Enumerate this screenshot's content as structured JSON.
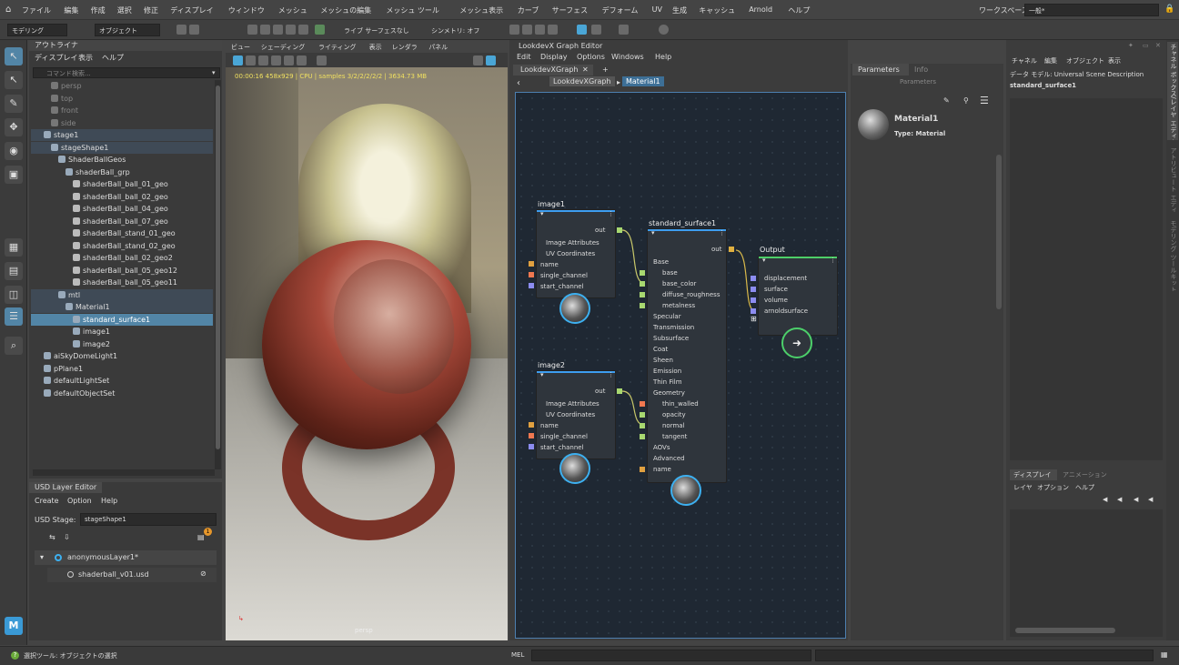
{
  "menubar": {
    "items": [
      "ファイル",
      "編集",
      "作成",
      "選択",
      "修正",
      "ディスプレイ",
      "ウィンドウ",
      "メッシュ",
      "メッシュの編集",
      "メッシュ ツール",
      "メッシュ表示",
      "カーブ",
      "サーフェス",
      "デフォーム",
      "UV",
      "生成",
      "キャッシュ",
      "Arnold",
      "ヘルプ"
    ],
    "workspace_label": "ワークスペース :",
    "workspace_value": "一般*"
  },
  "toolbar": {
    "mode": "モデリング",
    "object_label": "オブジェクト",
    "live_surface": "ライブ サーフェスなし",
    "symmetry": "シンメトリ: オフ"
  },
  "outliner": {
    "title": "アウトライナ",
    "menu": [
      "ディスプレイ",
      "表示",
      "ヘルプ"
    ],
    "search_placeholder": "コマンド検索...",
    "rows": [
      {
        "label": "persp",
        "depth": 1,
        "state": "dim"
      },
      {
        "label": "top",
        "depth": 1,
        "state": "dim"
      },
      {
        "label": "front",
        "depth": 1,
        "state": "dim"
      },
      {
        "label": "side",
        "depth": 1,
        "state": "dim"
      },
      {
        "label": "stage1",
        "depth": 0,
        "state": "hl"
      },
      {
        "label": "stageShape1",
        "depth": 1,
        "state": "hl"
      },
      {
        "label": "ShaderBallGeos",
        "depth": 2,
        "state": ""
      },
      {
        "label": "shaderBall_grp",
        "depth": 3,
        "state": ""
      },
      {
        "label": "shaderBall_ball_01_geo",
        "depth": 4,
        "state": ""
      },
      {
        "label": "shaderBall_ball_02_geo",
        "depth": 4,
        "state": ""
      },
      {
        "label": "shaderBall_ball_04_geo",
        "depth": 4,
        "state": ""
      },
      {
        "label": "shaderBall_ball_07_geo",
        "depth": 4,
        "state": ""
      },
      {
        "label": "shaderBall_stand_01_geo",
        "depth": 4,
        "state": ""
      },
      {
        "label": "shaderBall_stand_02_geo",
        "depth": 4,
        "state": ""
      },
      {
        "label": "shaderBall_ball_02_geo2",
        "depth": 4,
        "state": ""
      },
      {
        "label": "shaderBall_ball_05_geo12",
        "depth": 4,
        "state": ""
      },
      {
        "label": "shaderBall_ball_05_geo11",
        "depth": 4,
        "state": ""
      },
      {
        "label": "mtl",
        "depth": 2,
        "state": "hl"
      },
      {
        "label": "Material1",
        "depth": 3,
        "state": "hl"
      },
      {
        "label": "standard_surface1",
        "depth": 4,
        "state": "sel"
      },
      {
        "label": "image1",
        "depth": 4,
        "state": ""
      },
      {
        "label": "image2",
        "depth": 4,
        "state": ""
      },
      {
        "label": "aiSkyDomeLight1",
        "depth": 0,
        "state": ""
      },
      {
        "label": "pPlane1",
        "depth": 0,
        "state": ""
      },
      {
        "label": "defaultLightSet",
        "depth": 0,
        "state": ""
      },
      {
        "label": "defaultObjectSet",
        "depth": 0,
        "state": ""
      }
    ]
  },
  "usd": {
    "title": "USD Layer Editor",
    "menu": [
      "Create",
      "Option",
      "Help"
    ],
    "stage_label": "USD Stage:",
    "stage_value": "stageShape1",
    "badge": "1",
    "layer": "anonymousLayer1*",
    "sublayer": "shaderball_v01.usd"
  },
  "viewport": {
    "menu": [
      "ビュー",
      "シェーディング",
      "ライティング",
      "表示",
      "レンダラ",
      "パネル"
    ],
    "hud": "00:00:16 458x929 | CPU | samples 3/2/2/2/2/2 | 3634.73 MB",
    "camera": "persp"
  },
  "graph": {
    "title": "LookdevX Graph Editor",
    "menu": [
      "Edit",
      "Display",
      "Options",
      "Windows",
      "Help"
    ],
    "tab": "LookdevXGraph",
    "crumbs": [
      "LookdevXGraph",
      "Material1"
    ],
    "nodes": {
      "image1": {
        "title": "image1",
        "out": "out",
        "rows": [
          "Image Attributes",
          "UV Coordinates",
          "name",
          "single_channel",
          "start_channel"
        ]
      },
      "image2": {
        "title": "image2",
        "out": "out",
        "rows": [
          "Image Attributes",
          "UV Coordinates",
          "name",
          "single_channel",
          "start_channel"
        ]
      },
      "surface": {
        "title": "standard_surface1",
        "out": "out",
        "rows": [
          "Base",
          "base",
          "base_color",
          "diffuse_roughness",
          "metalness",
          "Specular",
          "Transmission",
          "Subsurface",
          "Coat",
          "Sheen",
          "Emission",
          "Thin Film",
          "Geometry",
          "thin_walled",
          "opacity",
          "normal",
          "tangent",
          "AOVs",
          "Advanced",
          "name"
        ]
      },
      "output": {
        "title": "Output",
        "rows": [
          "displacement",
          "surface",
          "volume",
          "arnoldsurface"
        ]
      }
    }
  },
  "params": {
    "tabs": [
      "Parameters",
      "Info"
    ],
    "sub": "Parameters",
    "name": "Material1",
    "type": "Type: Material"
  },
  "attr": {
    "menu": [
      "チャネル",
      "編集",
      "オブジェクト",
      "表示"
    ],
    "model": "データ モデル: Universal Scene Description",
    "node": "standard_surface1"
  },
  "channel": {
    "tabs": [
      "ディスプレイ",
      "アニメーション"
    ],
    "menu": [
      "レイヤ",
      "オプション",
      "ヘルプ"
    ]
  },
  "sidetabs": [
    "チャネル ボックス/レイヤ エディタ",
    "アトリビュート エディタ",
    "モデリング ツールキット"
  ],
  "status": {
    "help": "選択ツール: オブジェクトの選択",
    "mel": "MEL"
  }
}
